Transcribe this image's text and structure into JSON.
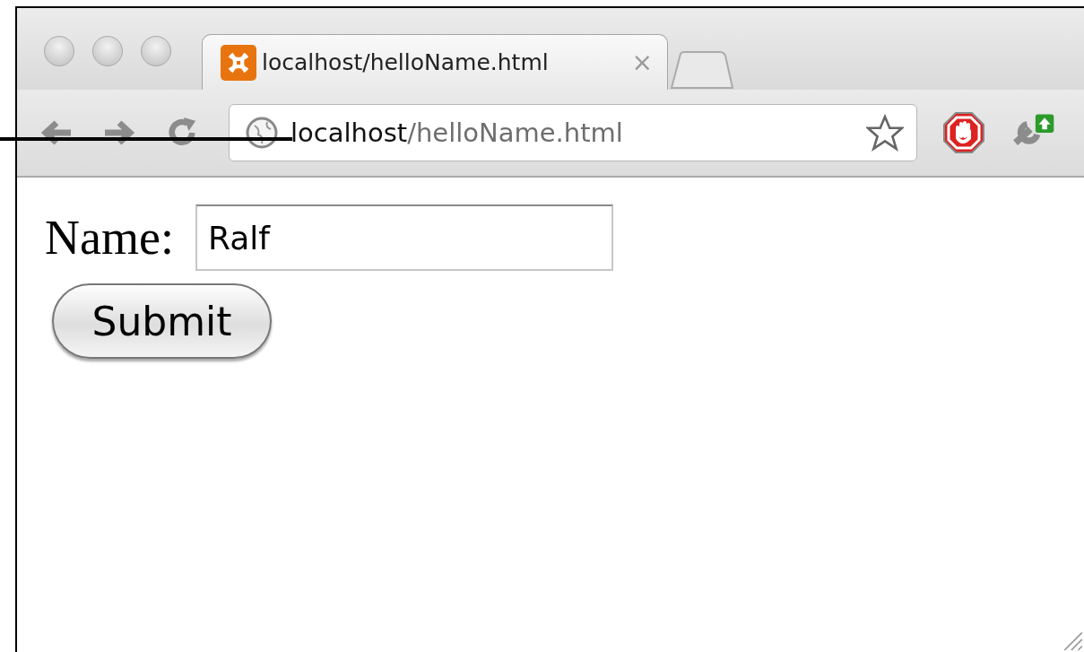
{
  "tabs": [
    {
      "title": "localhost/helloName.html",
      "close": "×",
      "selected": true
    }
  ],
  "address_bar": {
    "host": "localhost",
    "path": "/helloName.html"
  },
  "form": {
    "label": "Name:",
    "value": "Ralf",
    "button": "Submit"
  }
}
